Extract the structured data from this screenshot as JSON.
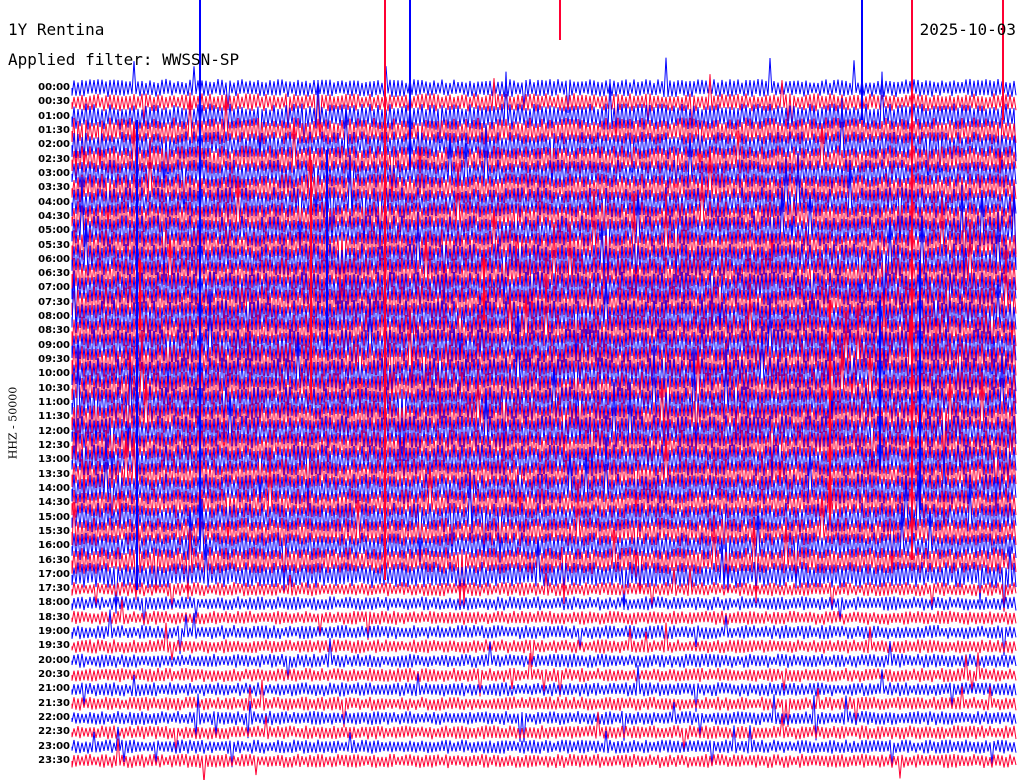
{
  "header": {
    "station": "1Y Rentina",
    "date": "2025-10-03",
    "filter": "Applied filter: WWSSN-SP"
  },
  "axis": {
    "ylabel": "HHZ - 50000"
  },
  "time_labels": [
    "00:00",
    "00:30",
    "01:00",
    "01:30",
    "02:00",
    "02:30",
    "03:00",
    "03:30",
    "04:00",
    "04:30",
    "05:00",
    "05:30",
    "06:00",
    "06:30",
    "07:00",
    "07:30",
    "08:00",
    "08:30",
    "09:00",
    "09:30",
    "10:00",
    "10:30",
    "11:00",
    "11:30",
    "12:00",
    "12:30",
    "13:00",
    "13:30",
    "14:00",
    "14:30",
    "15:00",
    "15:30",
    "16:00",
    "16:30",
    "17:00",
    "17:30",
    "18:00",
    "18:30",
    "19:00",
    "19:30",
    "20:00",
    "20:30",
    "21:00",
    "21:30",
    "22:00",
    "22:30",
    "23:00",
    "23:30"
  ],
  "colors": {
    "trace_a": "#0000ff",
    "trace_b": "#ff0033",
    "background": "#ffffff"
  }
}
